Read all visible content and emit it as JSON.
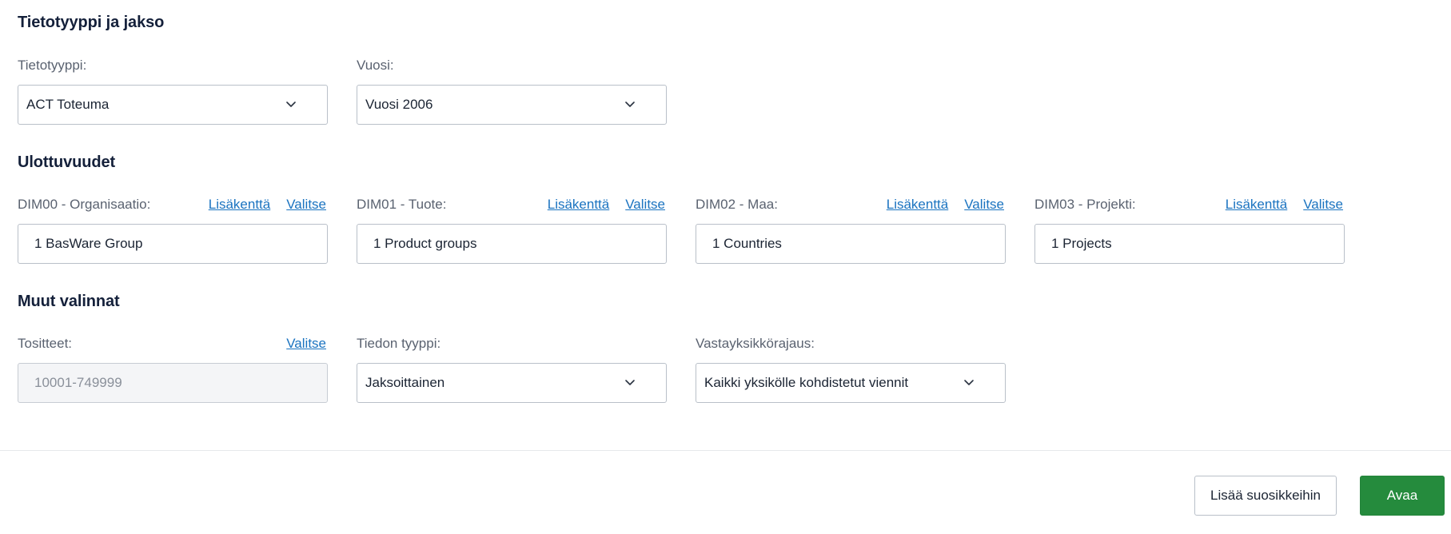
{
  "sections": {
    "type_period": {
      "title": "Tietotyyppi ja jakso",
      "data_type": {
        "label": "Tietotyyppi:",
        "value": "ACT Toteuma"
      },
      "year": {
        "label": "Vuosi:",
        "value": "Vuosi 2006"
      }
    },
    "dimensions": {
      "title": "Ulottuvuudet",
      "extra_link": "Lisäkenttä",
      "select_link": "Valitse",
      "items": [
        {
          "label": "DIM00 - Organisaatio:",
          "value": "1 BasWare Group"
        },
        {
          "label": "DIM01 - Tuote:",
          "value": "1 Product groups"
        },
        {
          "label": "DIM02 - Maa:",
          "value": "1 Countries"
        },
        {
          "label": "DIM03 - Projekti:",
          "value": "1 Projects"
        }
      ]
    },
    "other": {
      "title": "Muut valinnat",
      "vouchers": {
        "label": "Tositteet:",
        "link": "Valitse",
        "value": "10001-749999"
      },
      "info_type": {
        "label": "Tiedon tyyppi:",
        "value": "Jaksoittainen"
      },
      "counter_unit": {
        "label": "Vastayksikkörajaus:",
        "value": "Kaikki yksikölle kohdistetut viennit"
      }
    }
  },
  "footer": {
    "add_favorite_label": "Lisää suosikkeihin",
    "open_label": "Avaa"
  },
  "colors": {
    "link": "#1a73c0",
    "primary": "#258b3d",
    "heading": "#14203a"
  }
}
